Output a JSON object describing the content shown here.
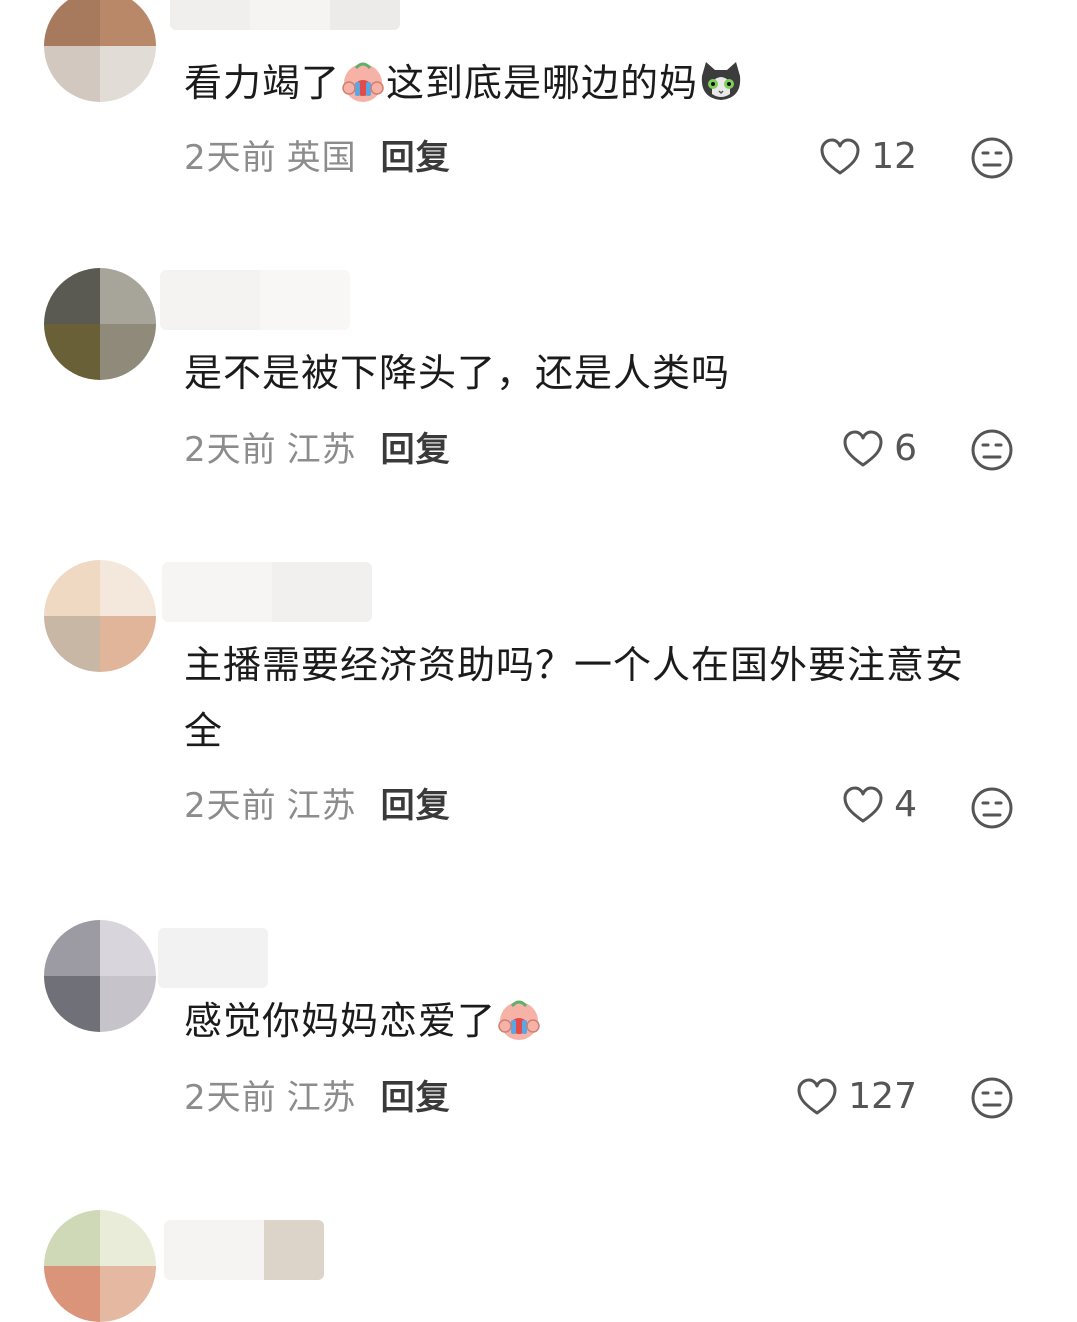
{
  "comments": [
    {
      "text_before": "看力竭了",
      "text_middle": "这到底是哪边的妈",
      "time": "2天前",
      "region": "英国",
      "reply_label": "回复",
      "likes": "12"
    },
    {
      "text": "是不是被下降头了，还是人类吗",
      "time": "2天前",
      "region": "江苏",
      "reply_label": "回复",
      "likes": "6"
    },
    {
      "text_line1": "主播需要经济资助吗？一个人在国外要注意安",
      "text_line2": "全",
      "time": "2天前",
      "region": "江苏",
      "reply_label": "回复",
      "likes": "4"
    },
    {
      "text": "感觉你妈妈恋爱了",
      "time": "2天前",
      "region": "江苏",
      "reply_label": "回复",
      "likes": "127"
    }
  ],
  "icons": {
    "like": "heart-outline-icon",
    "dislike": "meh-face-icon",
    "emoji_cry": "crying-baby-emoji",
    "emoji_cat": "cat-face-emoji"
  },
  "colors": {
    "text": "#1b1b1b",
    "meta": "#8c8c8c",
    "reply": "#3a3a3a"
  }
}
